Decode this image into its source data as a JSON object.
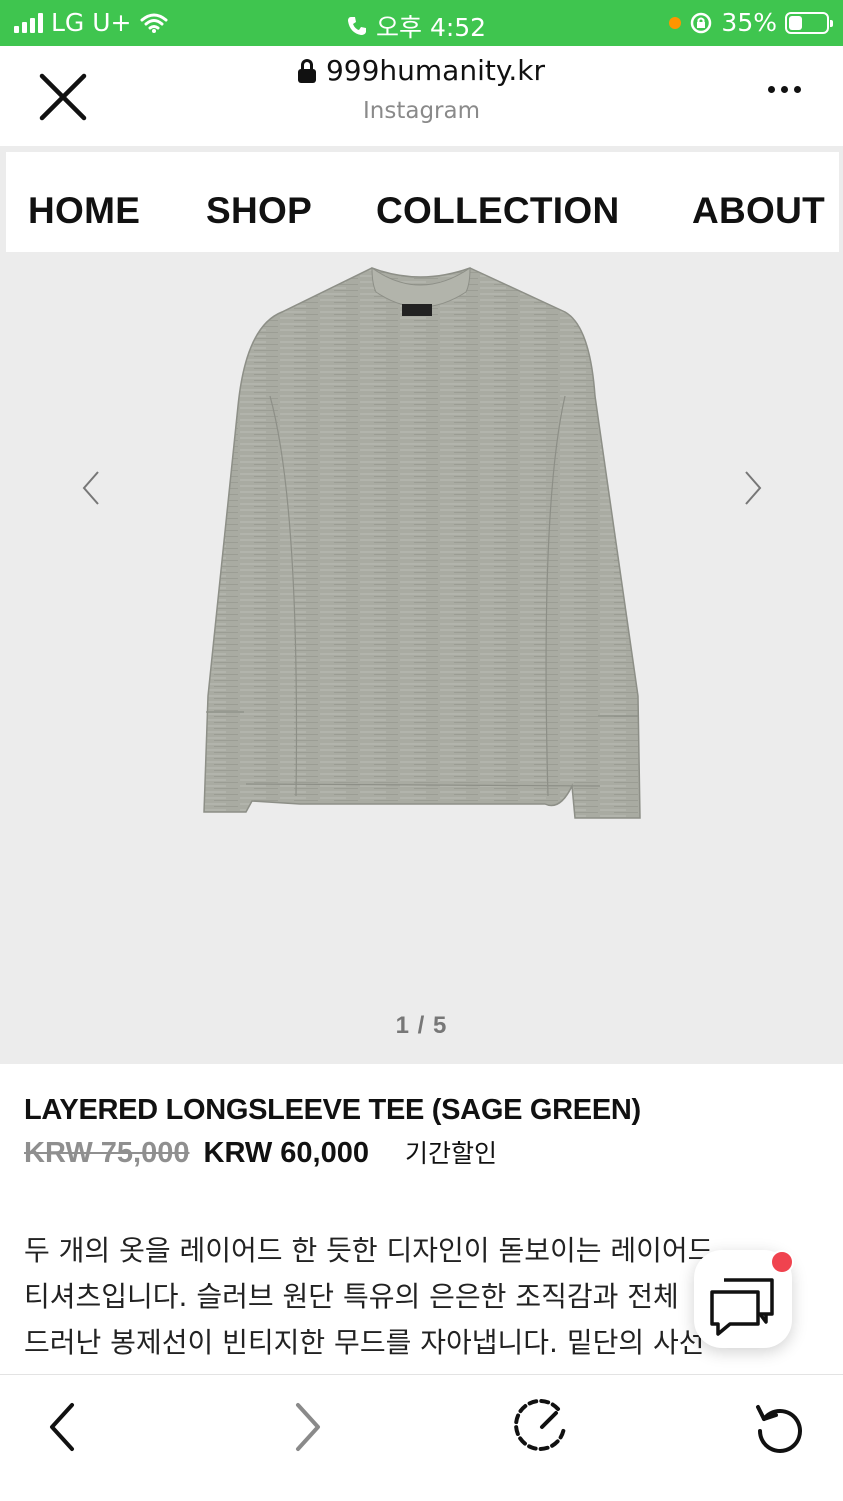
{
  "status_bar": {
    "carrier": "LG U+",
    "time": "오후 4:52",
    "battery_percent": "35%",
    "battery_level": 0.35,
    "background_color": "#3fc54f"
  },
  "browser": {
    "url": "999humanity.kr",
    "subtitle": "Instagram",
    "icons": {
      "close": "close-icon",
      "lock": "lock-icon",
      "more": "more-icon"
    }
  },
  "nav": {
    "items": [
      {
        "label": "HOME"
      },
      {
        "label": "SHOP"
      },
      {
        "label": "COLLECTION"
      },
      {
        "label": "ABOUT"
      }
    ]
  },
  "gallery": {
    "counter": "1 / 5",
    "product_color": "#a9aba2"
  },
  "product": {
    "title": "LAYERED LONGSLEEVE TEE (SAGE GREEN)",
    "original_price": "KRW 75,000",
    "sale_price": "KRW 60,000",
    "badge": "기간할인",
    "description_lines": [
      "두 개의 옷을 레이어드 한 듯한 디자인이 돋보이는 레이어드",
      "티셔츠입니다. 슬러브 원단 특유의 은은한 조직감과 전체",
      "드러난 봉제선이 빈티지한 무드를 자아냅니다. 밑단의 사선"
    ]
  },
  "chat": {
    "icon": "chat-icon",
    "badge_color": "#f0434f"
  },
  "toolbar": {
    "icons": [
      "back-icon",
      "forward-icon",
      "compass-icon",
      "refresh-icon"
    ]
  }
}
